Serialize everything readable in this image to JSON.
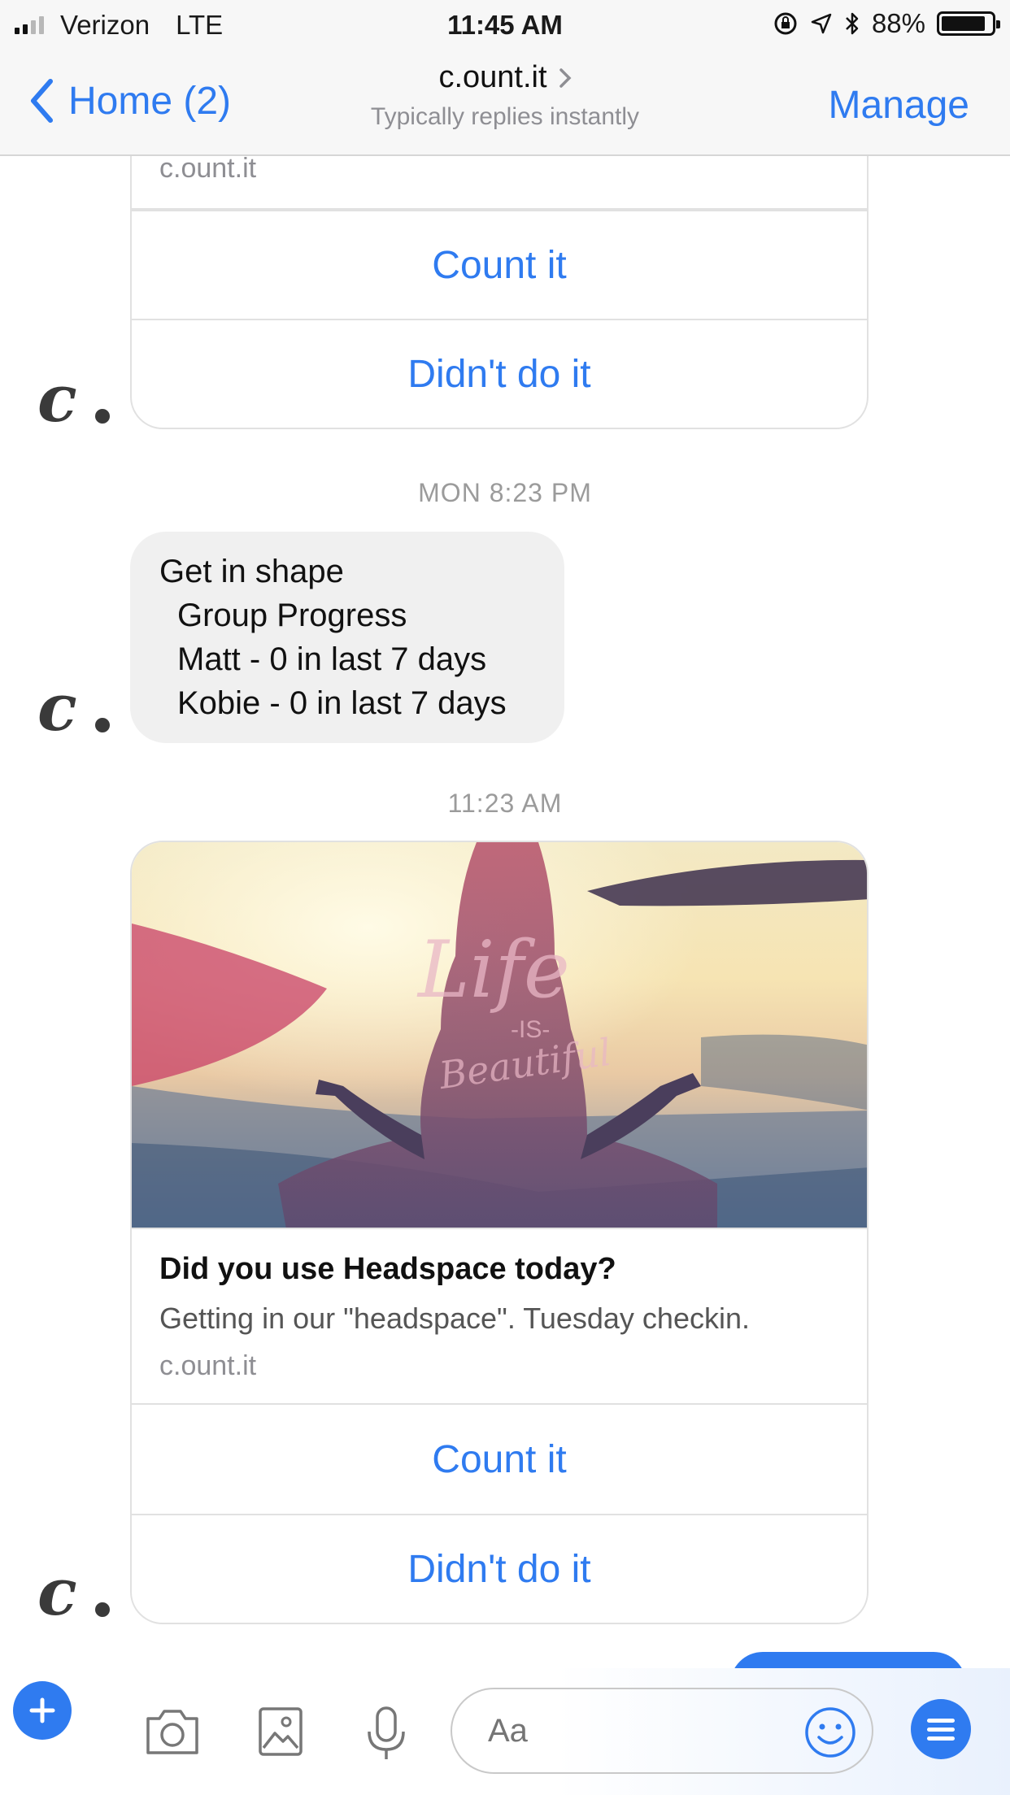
{
  "status_bar": {
    "carrier": "Verizon",
    "network": "LTE",
    "time": "11:45 AM",
    "battery": "88%",
    "battery_level": 0.88
  },
  "nav": {
    "back_label": "Home (2)",
    "title": "c.ount.it",
    "subtitle": "Typically replies instantly",
    "manage_label": "Manage"
  },
  "messages": {
    "card1": {
      "domain": "c.ount.it",
      "count_label": "Count it",
      "didnt_label": "Didn't do it"
    },
    "timestamp1": "MON 8:23 PM",
    "text_bubble": {
      "line1": "Get in shape",
      "line2": "Group Progress",
      "line3": "Matt - 0 in last 7 days",
      "line4": "Kobie - 0 in last 7 days"
    },
    "timestamp2": "11:23 AM",
    "card2": {
      "image_text_1": "Life",
      "image_text_2": "-IS-",
      "image_text_3": "Beautiful",
      "title": "Did you use Headspace today?",
      "description": "Getting in our \"headspace\". Tuesday checkin.",
      "domain": "c.ount.it",
      "count_label": "Count it",
      "didnt_label": "Didn't do it"
    },
    "avatar_letter": "c."
  },
  "composer": {
    "placeholder": "Aa"
  },
  "colors": {
    "accent": "#2f7bf0",
    "bubble": "#f0f0f0",
    "avatar": "#3a3a3a"
  },
  "icons": [
    "signal-icon",
    "lock-rotation-icon",
    "location-arrow-icon",
    "bluetooth-icon",
    "battery-icon",
    "chevron-left-icon",
    "chevron-right-icon",
    "plus-icon",
    "camera-icon",
    "image-icon",
    "microphone-icon",
    "smiley-icon",
    "menu-icon"
  ]
}
